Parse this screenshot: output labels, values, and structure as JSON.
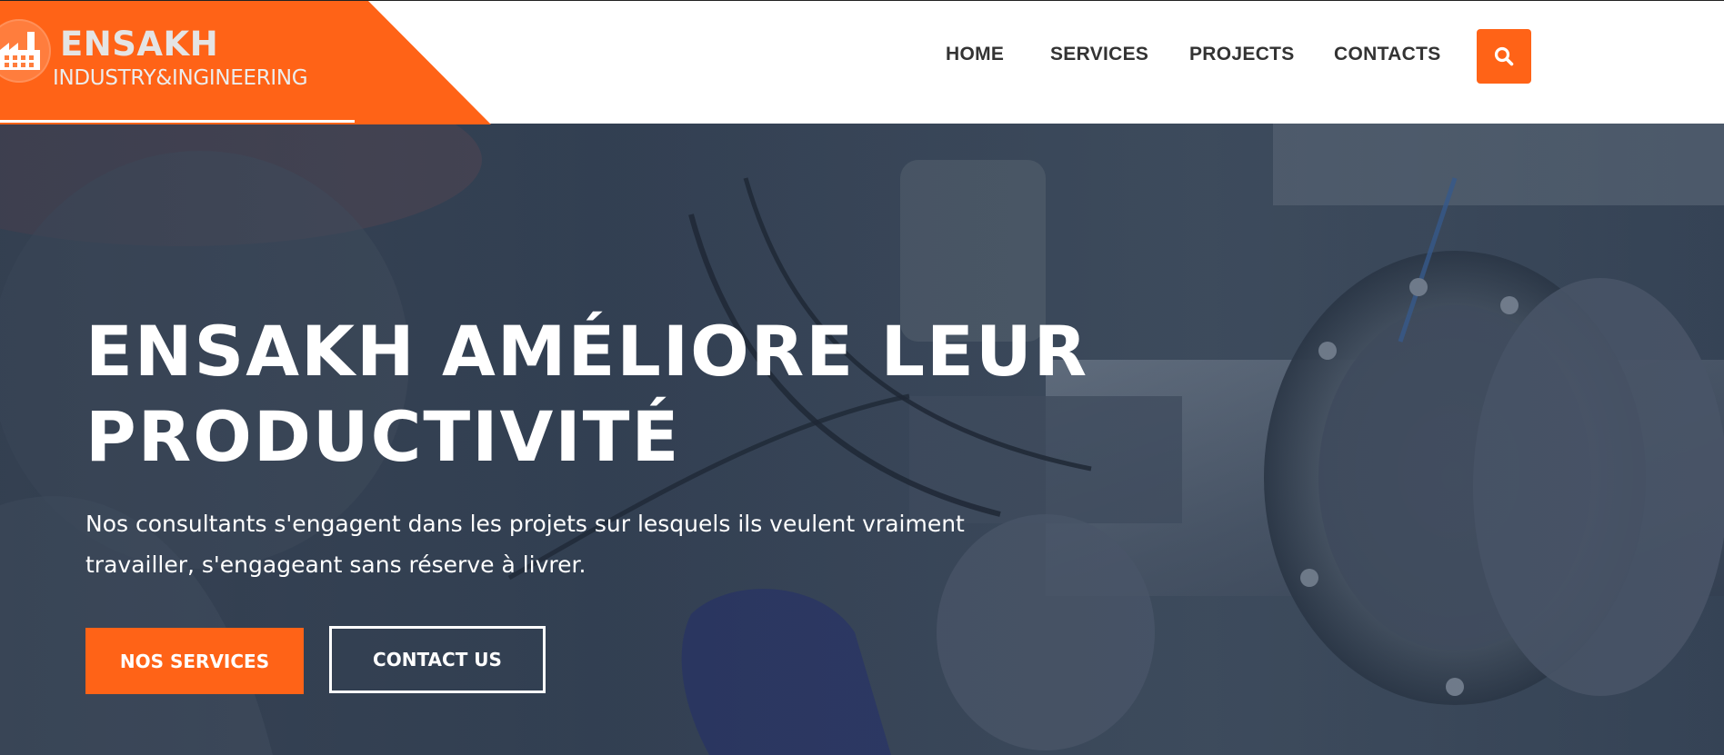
{
  "brand": {
    "name": "ENSAKH",
    "tagline": "INDUSTRY&INGINEERING",
    "icon": "factory-icon",
    "color": "#ff6317"
  },
  "nav": {
    "items": [
      {
        "label": "HOME"
      },
      {
        "label": "SERVICES"
      },
      {
        "label": "PROJECTS"
      },
      {
        "label": "CONTACTS"
      }
    ],
    "search_icon": "search-icon"
  },
  "hero": {
    "title_line1": "ENSAKH AMÉLIORE LEUR",
    "title_line2": "PRODUCTIVITÉ",
    "description_line1": "Nos consultants s'engagent dans les projets sur lesquels ils veulent vraiment",
    "description_line2": "travailler, s'engageant sans réserve à livrer.",
    "primary_button": "NOS SERVICES",
    "secondary_button": "CONTACT US"
  },
  "colors": {
    "accent": "#ff6317",
    "nav_text": "#333333",
    "hero_overlay": "#202d40"
  }
}
